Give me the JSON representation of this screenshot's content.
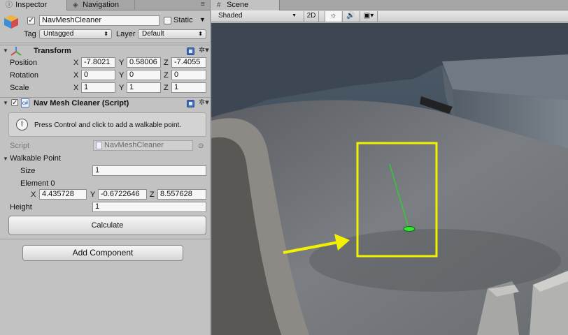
{
  "inspector_tabs": [
    {
      "label": "Inspector",
      "icon": "info-icon"
    },
    {
      "label": "Navigation",
      "icon": "compass-icon"
    }
  ],
  "game_object": {
    "active": true,
    "name": "NavMeshCleaner",
    "static_label": "Static",
    "static_checked": false,
    "tag_label": "Tag",
    "tag_value": "Untagged",
    "layer_label": "Layer",
    "layer_value": "Default"
  },
  "transform": {
    "title": "Transform",
    "rows": [
      {
        "label": "Position",
        "x": "-7.8021",
        "y": "0.58006",
        "z": "-7.4055"
      },
      {
        "label": "Rotation",
        "x": "0",
        "y": "0",
        "z": "0"
      },
      {
        "label": "Scale",
        "x": "1",
        "y": "1",
        "z": "1"
      }
    ],
    "axis_x": "X",
    "axis_y": "Y",
    "axis_z": "Z"
  },
  "script_component": {
    "title": "Nav Mesh Cleaner (Script)",
    "help_text": "Press Control and click to add a walkable point.",
    "script_label": "Script",
    "script_value": "NavMeshCleaner",
    "walkable_label": "Walkable Point",
    "size_label": "Size",
    "size_value": "1",
    "element_label": "Element 0",
    "element_x": "4.435728",
    "element_y": "-0.6722646",
    "element_z": "8.557628",
    "height_label": "Height",
    "height_value": "1",
    "calculate_label": "Calculate"
  },
  "add_component_label": "Add Component",
  "scene": {
    "tab_label": "Scene",
    "shading_mode": "Shaded",
    "mode_2d": "2D",
    "highlight_color": "#f2f200",
    "arrow_color": "#f2f200",
    "gizmo_color": "#22dd22"
  }
}
